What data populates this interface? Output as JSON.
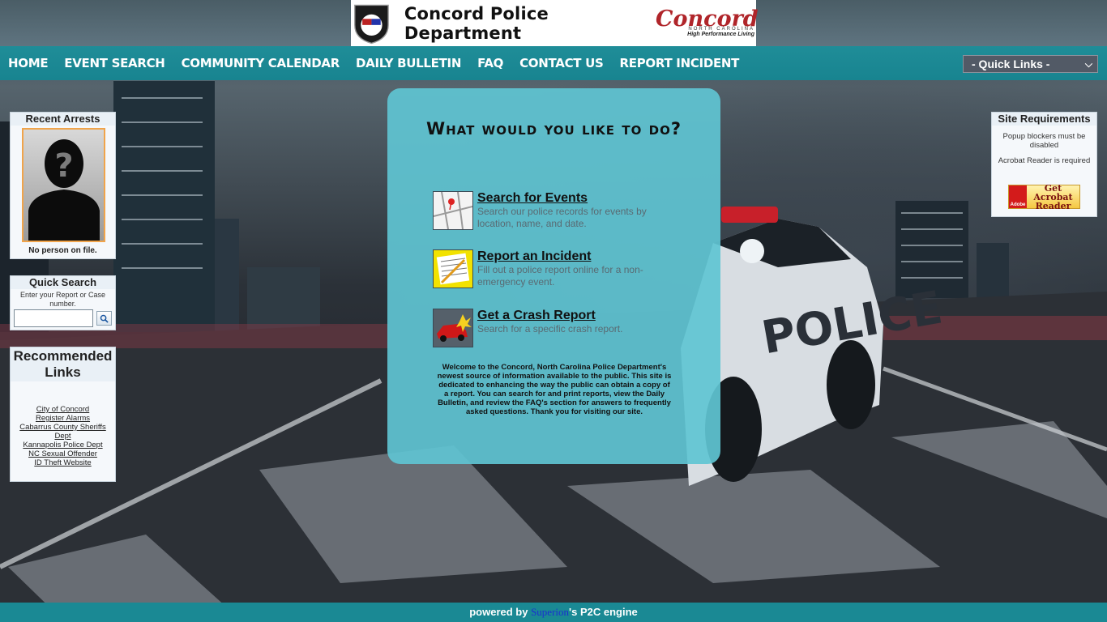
{
  "banner": {
    "badge_text": "POLICE",
    "badge_city": "Concord",
    "badge_est": "Est. 1796",
    "dept_name": "Concord Police Department",
    "city_script": "Concord",
    "city_state": "NORTH CAROLINA",
    "city_tagline": "High Performance Living"
  },
  "nav": {
    "items": [
      "HOME",
      "EVENT SEARCH",
      "COMMUNITY CALENDAR",
      "DAILY BULLETIN",
      "FAQ",
      "CONTACT US",
      "REPORT INCIDENT"
    ],
    "quick_links_selected": "- Quick Links -"
  },
  "recent_arrests": {
    "title": "Recent Arrests",
    "caption": "No person on file."
  },
  "quick_search": {
    "title": "Quick Search",
    "hint": "Enter your Report or Case number.",
    "input_value": "",
    "input_placeholder": ""
  },
  "recommended": {
    "title": "Recommended Links",
    "links": [
      "City of Concord",
      "Register Alarms",
      "Cabarrus County Sheriffs Dept",
      "Kannapolis Police Dept",
      "NC Sexual Offender",
      "ID Theft Website"
    ]
  },
  "site_requirements": {
    "title": "Site Requirements",
    "items": [
      "Popup blockers must be disabled",
      "Acrobat Reader is required"
    ],
    "acrobat_label": "Get Acrobat Reader",
    "acrobat_brand": "Adobe"
  },
  "main": {
    "title": "What would you like to do?",
    "actions": [
      {
        "title": "Search for Events",
        "desc": "Search our police records for events by location, name, and date."
      },
      {
        "title": "Report an Incident",
        "desc": "Fill out a police report online for a non-emergency event."
      },
      {
        "title": "Get a Crash Report",
        "desc": "Search for a specific crash report."
      }
    ],
    "welcome": "Welcome to the Concord, North Carolina Police Department's newest source of information available to the public. This site is dedicated to enhancing the way the public can obtain a copy of a report. You can search for and print reports, view the Daily Bulletin, and review the FAQ's section for answers to frequently asked questions. Thank you for visiting our site."
  },
  "footer": {
    "prefix": "powered by ",
    "vendor": "Superion",
    "suffix": "'s P2C engine"
  },
  "colors": {
    "nav_bg": "#1f8d98",
    "card_bg": "#60c4d2",
    "footer_bg": "#1a8994",
    "mugshot_border": "#f0a44b"
  },
  "icons": {
    "search": "magnifier-icon",
    "events": "map-icon",
    "incident": "report-form-icon",
    "crash": "car-crash-icon"
  }
}
